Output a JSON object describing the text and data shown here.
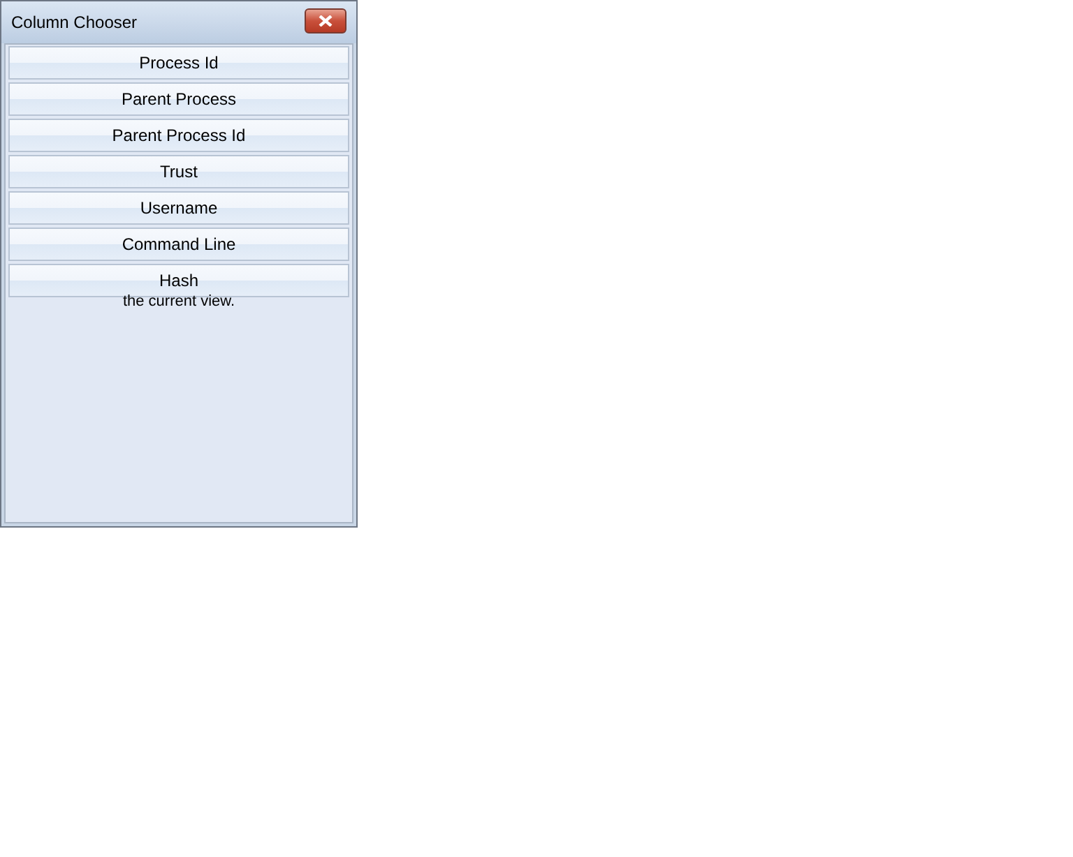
{
  "window": {
    "title": "Column Chooser"
  },
  "columns": [
    {
      "label": "Process Id"
    },
    {
      "label": "Parent Process"
    },
    {
      "label": "Parent Process Id"
    },
    {
      "label": "Trust"
    },
    {
      "label": "Username"
    },
    {
      "label": "Command Line"
    },
    {
      "label": "Hash"
    }
  ],
  "hint": "the current view."
}
